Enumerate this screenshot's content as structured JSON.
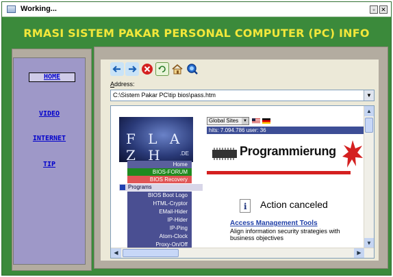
{
  "window": {
    "title": "Working..."
  },
  "titlebar_buttons": {
    "restore": "▫",
    "close": "✕"
  },
  "app": {
    "title": "RMASI SISTEM PAKAR PERSONAL COMPUTER (PC) INFO"
  },
  "nav": {
    "items": [
      {
        "label": "HOME",
        "active": true
      },
      {
        "label": "VIDEO"
      },
      {
        "label": "INTERNET"
      },
      {
        "label": "TIP"
      }
    ]
  },
  "browser": {
    "toolbar": {
      "icons": [
        "back-icon",
        "forward-icon",
        "stop-icon",
        "refresh-icon",
        "home-icon",
        "search-icon"
      ]
    },
    "address_label_prefix": "A",
    "address_label_rest": "ddress:",
    "address_value": "C:\\Sistem Pakar PC\\tip bios\\pass.htm",
    "page": {
      "logo_text": "F L A Z H",
      "logo_domain": ".DE",
      "menu": [
        "Home",
        "BIOS-FORUM",
        "BIOS Recovery"
      ],
      "programs_header": "Programs",
      "programs": [
        "BIOS Boot Logo",
        "HTML-Cryptor",
        "EMail-Hider",
        "IP-Hider",
        "IP-Ping",
        "Atom-Clock",
        "Proxy-On/Off"
      ],
      "global_select": "Global Sites",
      "hits": "hits: 7.094.786   user: 36",
      "banner": "Programmierung",
      "action": "Action canceled",
      "amt_title": "Access Management Tools",
      "amt_desc": "Align information security strategies with business objectives"
    }
  },
  "colors": {
    "accent_green": "#3b8a3b",
    "title_yellow": "#f2e73a",
    "nav_link": "#0000cc"
  }
}
